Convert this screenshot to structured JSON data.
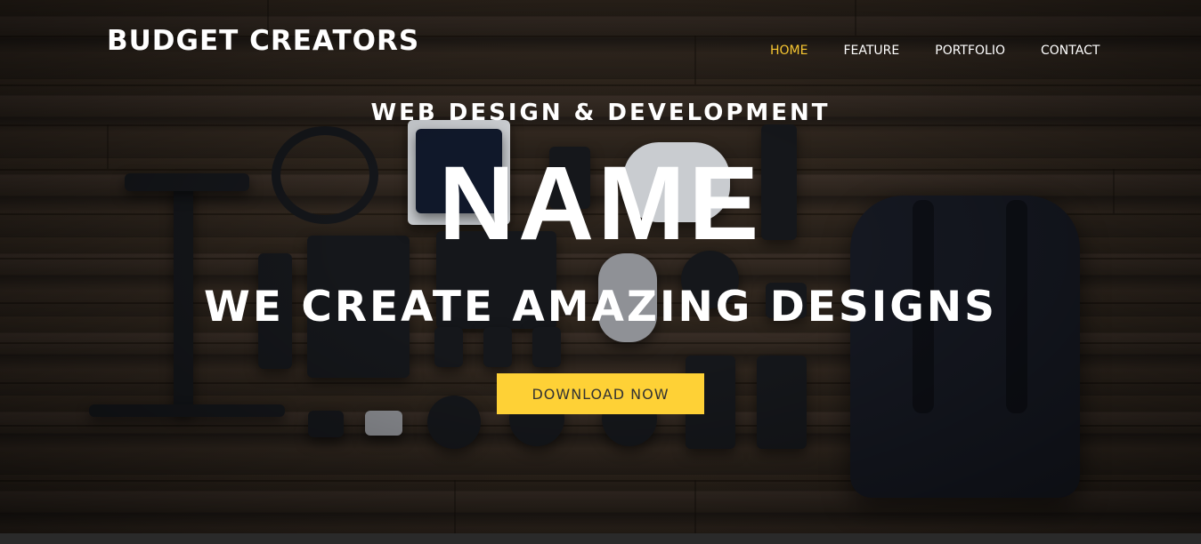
{
  "header": {
    "logo": "BUDGET CREATORS",
    "nav": [
      {
        "label": "HOME",
        "active": true
      },
      {
        "label": "FEATURE",
        "active": false
      },
      {
        "label": "PORTFOLIO",
        "active": false
      },
      {
        "label": "CONTACT",
        "active": false
      }
    ]
  },
  "hero": {
    "subtitle": "WEB DESIGN & DEVELOPMENT",
    "name": "NAME",
    "tagline": "WE CREATE AMAZING DESIGNS",
    "cta_label": "DOWNLOAD NOW"
  },
  "colors": {
    "accent": "#fed136",
    "active_nav": "#f7c631",
    "text": "#ffffff",
    "button_text": "#333333"
  },
  "background": {
    "description_icon": "camera-gear-flatlay-image"
  }
}
